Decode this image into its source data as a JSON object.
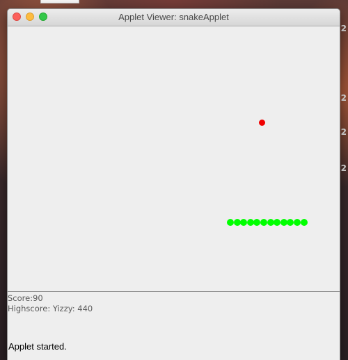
{
  "desktop": {
    "wallpaper": "mountain-dusk-wallpaper",
    "edge_marks": [
      "2",
      "2",
      "2",
      "2"
    ]
  },
  "window": {
    "title": "Applet Viewer: snakeApplet",
    "buttons": {
      "close": "close-button",
      "minimize": "minimize-button",
      "zoom": "zoom-button"
    }
  },
  "game": {
    "background_color": "#eeeeee",
    "food_color": "#f00000",
    "snake_color": "#00ff00",
    "snake_length": 12
  },
  "score": {
    "label": "Score:",
    "value": "90",
    "highscore_label": "Highscore:",
    "highscore_name": "Yizzy:",
    "highscore_value": "440"
  },
  "status": {
    "text": "Applet started."
  }
}
